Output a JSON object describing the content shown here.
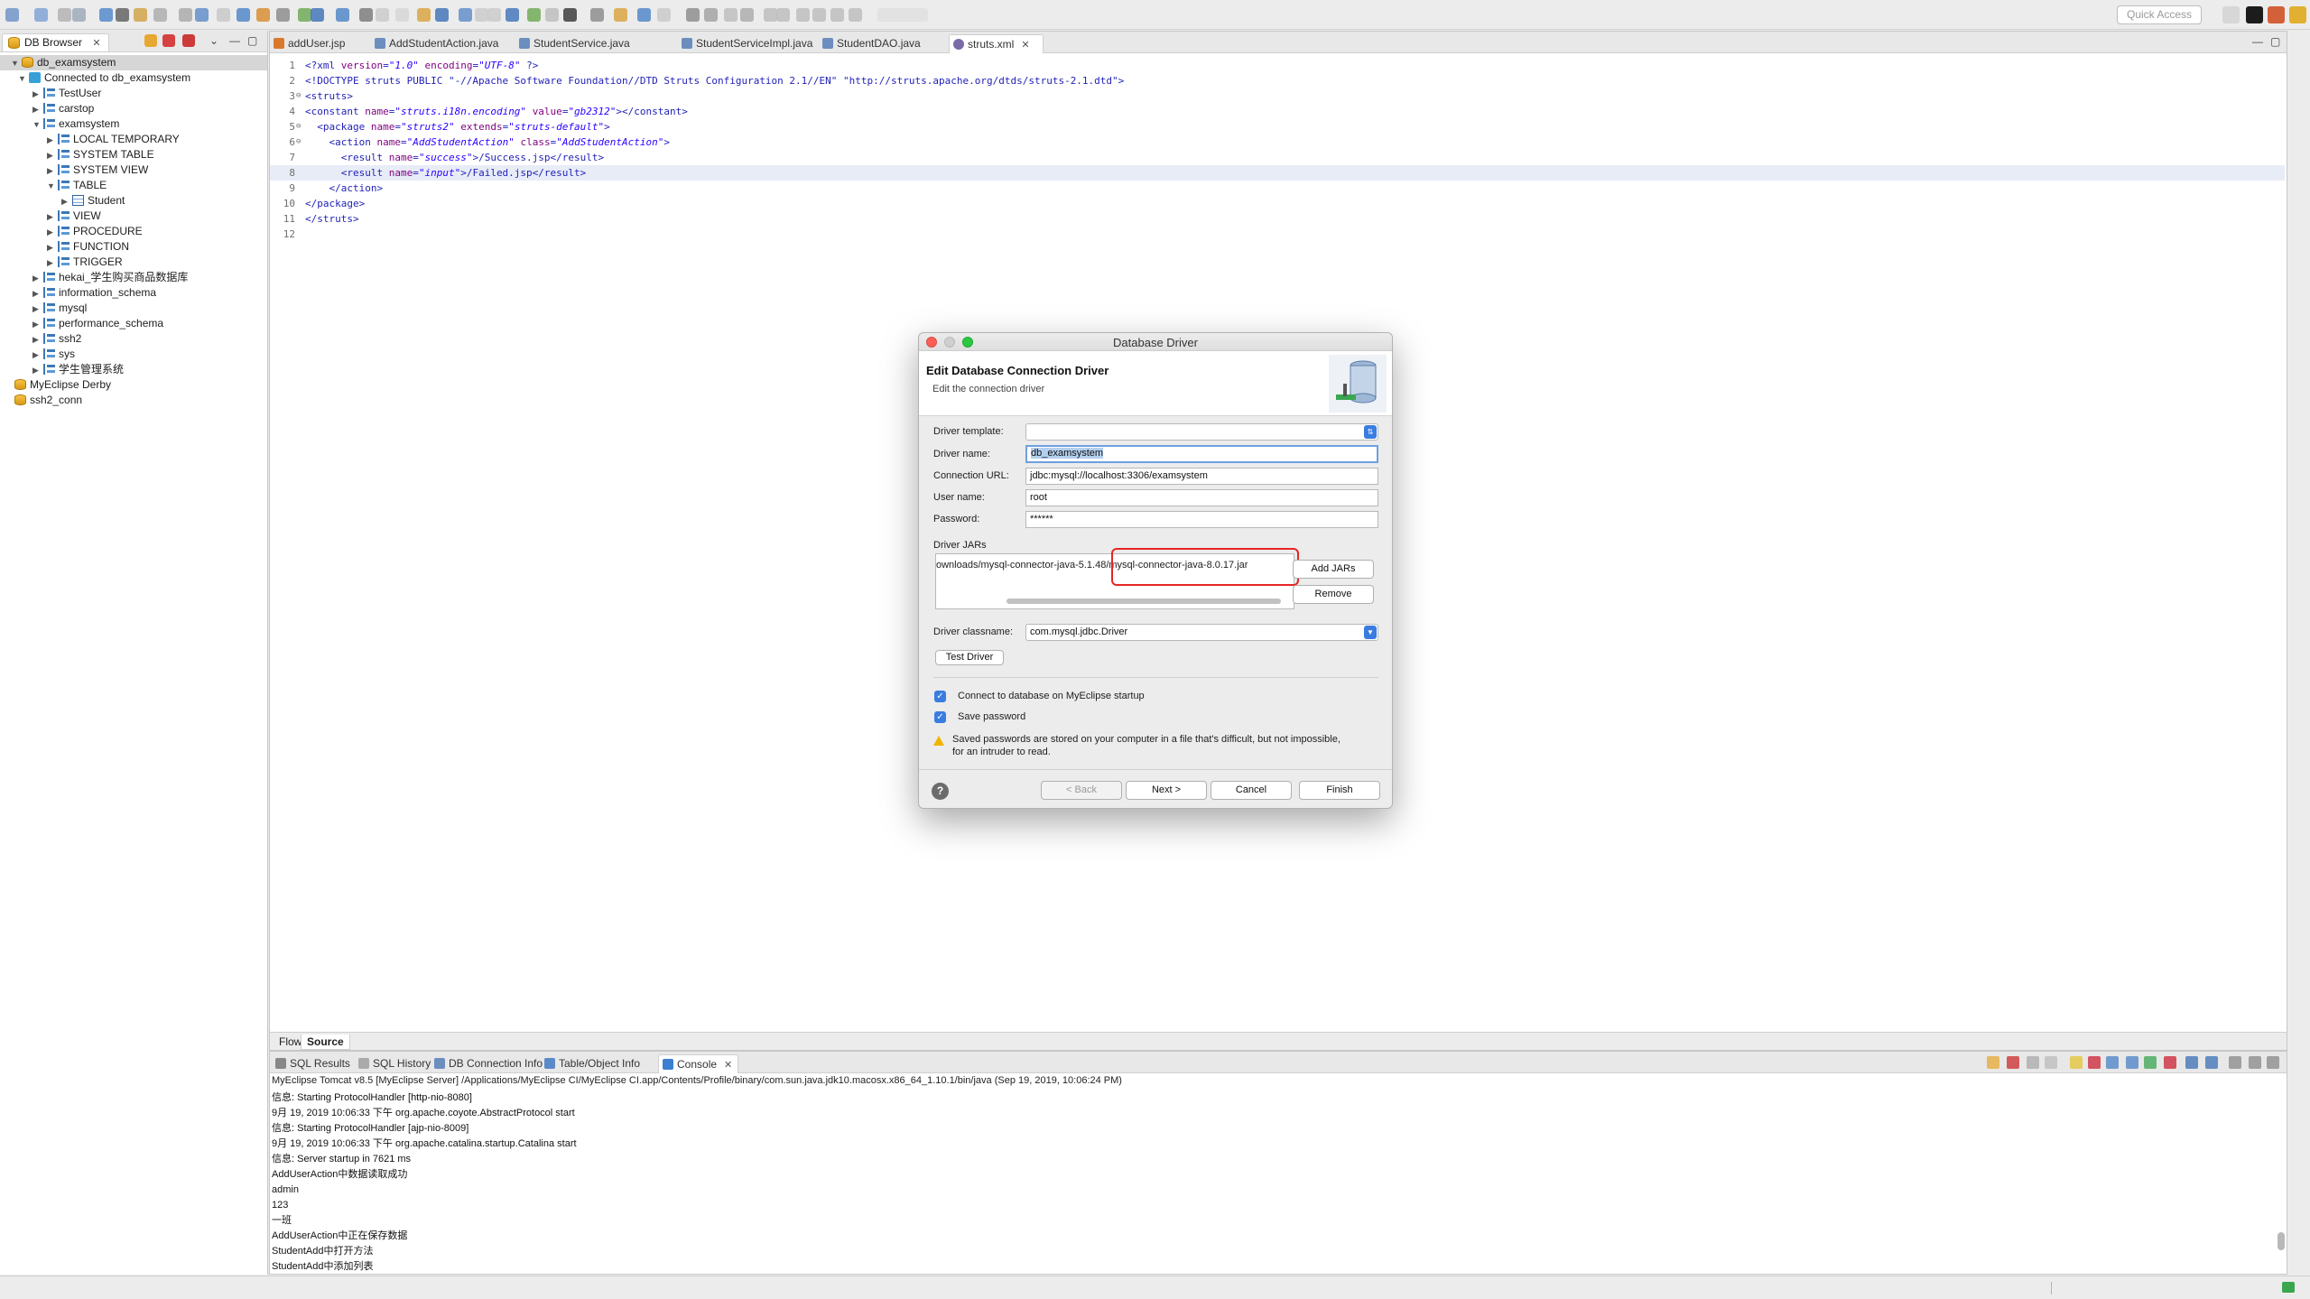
{
  "toolbar": {
    "quick_access_placeholder": "Quick Access"
  },
  "left_panel": {
    "tab_label": "DB Browser",
    "tree": [
      {
        "label": "db_examsystem",
        "depth": 0,
        "arrow": "▼",
        "icon": "database-icon",
        "selected": true
      },
      {
        "label": "Connected to db_examsystem",
        "depth": 1,
        "arrow": "▼",
        "icon": "connection-icon"
      },
      {
        "label": "TestUser",
        "depth": 2,
        "arrow": "▶",
        "icon": "schema-icon"
      },
      {
        "label": "carstop",
        "depth": 2,
        "arrow": "▶",
        "icon": "schema-icon"
      },
      {
        "label": "examsystem",
        "depth": 2,
        "arrow": "▼",
        "icon": "schema-icon"
      },
      {
        "label": "LOCAL TEMPORARY",
        "depth": 3,
        "arrow": "▶",
        "icon": "schema-icon"
      },
      {
        "label": "SYSTEM TABLE",
        "depth": 3,
        "arrow": "▶",
        "icon": "schema-icon"
      },
      {
        "label": "SYSTEM VIEW",
        "depth": 3,
        "arrow": "▶",
        "icon": "schema-icon"
      },
      {
        "label": "TABLE",
        "depth": 3,
        "arrow": "▼",
        "icon": "schema-icon"
      },
      {
        "label": "Student",
        "depth": 4,
        "arrow": "▶",
        "icon": "table-icon"
      },
      {
        "label": "VIEW",
        "depth": 3,
        "arrow": "▶",
        "icon": "schema-icon"
      },
      {
        "label": "PROCEDURE",
        "depth": 3,
        "arrow": "▶",
        "icon": "schema-icon"
      },
      {
        "label": "FUNCTION",
        "depth": 3,
        "arrow": "▶",
        "icon": "schema-icon"
      },
      {
        "label": "TRIGGER",
        "depth": 3,
        "arrow": "▶",
        "icon": "schema-icon"
      },
      {
        "label": "hekai_学生购买商品数据库",
        "depth": 2,
        "arrow": "▶",
        "icon": "schema-icon"
      },
      {
        "label": "information_schema",
        "depth": 2,
        "arrow": "▶",
        "icon": "schema-icon"
      },
      {
        "label": "mysql",
        "depth": 2,
        "arrow": "▶",
        "icon": "schema-icon"
      },
      {
        "label": "performance_schema",
        "depth": 2,
        "arrow": "▶",
        "icon": "schema-icon"
      },
      {
        "label": "ssh2",
        "depth": 2,
        "arrow": "▶",
        "icon": "schema-icon"
      },
      {
        "label": "sys",
        "depth": 2,
        "arrow": "▶",
        "icon": "schema-icon"
      },
      {
        "label": "学生管理系统",
        "depth": 2,
        "arrow": "▶",
        "icon": "schema-icon"
      },
      {
        "label": "MyEclipse Derby",
        "depth": 0,
        "arrow": "",
        "icon": "database-icon"
      },
      {
        "label": "ssh2_conn",
        "depth": 0,
        "arrow": "",
        "icon": "database-icon"
      }
    ]
  },
  "editor": {
    "tabs": [
      {
        "label": "addUser.jsp",
        "active": false
      },
      {
        "label": "AddStudentAction.java",
        "active": false
      },
      {
        "label": "StudentService.java",
        "active": false
      },
      {
        "label": "StudentServiceImpl.java",
        "active": false
      },
      {
        "label": "StudentDAO.java",
        "active": false
      },
      {
        "label": "struts.xml",
        "active": true
      }
    ],
    "lines": [
      {
        "n": "1",
        "fold": "",
        "text": "<?xml version=\"1.0\" encoding=\"UTF-8\" ?>"
      },
      {
        "n": "2",
        "fold": "",
        "text": "<!DOCTYPE struts PUBLIC \"-//Apache Software Foundation//DTD Struts Configuration 2.1//EN\" \"http://struts.apache.org/dtds/struts-2.1.dtd\">"
      },
      {
        "n": "3",
        "fold": "⊖",
        "text": "<struts>"
      },
      {
        "n": "4",
        "fold": "",
        "text": "<constant name=\"struts.i18n.encoding\" value=\"gb2312\"></constant>"
      },
      {
        "n": "5",
        "fold": "⊖",
        "text": "  <package name=\"struts2\" extends=\"struts-default\">"
      },
      {
        "n": "6",
        "fold": "⊖",
        "text": "    <action name=\"AddStudentAction\" class=\"AddStudentAction\">"
      },
      {
        "n": "7",
        "fold": "",
        "text": "      <result name=\"success\">/Success.jsp</result>"
      },
      {
        "n": "8",
        "fold": "",
        "text": "      <result name=\"input\">/Failed.jsp</result>",
        "current": true
      },
      {
        "n": "9",
        "fold": "",
        "text": "    </action>"
      },
      {
        "n": "10",
        "fold": "",
        "text": "</package>"
      },
      {
        "n": "11",
        "fold": "",
        "text": "</struts>"
      },
      {
        "n": "12",
        "fold": "",
        "text": ""
      }
    ],
    "bottom_tabs": {
      "flow": "Flow",
      "source": "Source"
    }
  },
  "console": {
    "tabs": [
      {
        "label": "SQL Results",
        "active": false
      },
      {
        "label": "SQL History",
        "active": false
      },
      {
        "label": "DB Connection Info",
        "active": false
      },
      {
        "label": "Table/Object Info",
        "active": false
      },
      {
        "label": "Console",
        "active": true
      }
    ],
    "header": "MyEclipse Tomcat v8.5 [MyEclipse Server] /Applications/MyEclipse CI/MyEclipse CI.app/Contents/Profile/binary/com.sun.java.jdk10.macosx.x86_64_1.10.1/bin/java (Sep 19, 2019, 10:06:24 PM)",
    "lines": [
      {
        "text": "信息: Starting ProtocolHandler [http-nio-8080]",
        "red": false
      },
      {
        "text": "9月 19, 2019 10:06:33 下午 org.apache.coyote.AbstractProtocol start",
        "red": false
      },
      {
        "text": "信息: Starting ProtocolHandler [ajp-nio-8009]",
        "red": false
      },
      {
        "text": "9月 19, 2019 10:06:33 下午 org.apache.catalina.startup.Catalina start",
        "red": false
      },
      {
        "text": "信息: Server startup in 7621 ms",
        "red": false
      },
      {
        "text": "AddUserAction中数据读取成功",
        "red": false
      },
      {
        "text": "admin",
        "red": false
      },
      {
        "text": "123",
        "red": false
      },
      {
        "text": "一班",
        "red": false
      },
      {
        "text": "AddUserAction中正在保存数据",
        "red": false
      },
      {
        "text": "StudentAdd中打开方法",
        "red": false
      },
      {
        "text": "StudentAdd中添加列表",
        "red": false
      }
    ]
  },
  "dialog": {
    "title": "Database Driver",
    "heading": "Edit Database Connection Driver",
    "subheading": "Edit the connection driver",
    "driver_template_label": "Driver template:",
    "driver_template_value": "",
    "driver_name_label": "Driver name:",
    "driver_name_value": "db_examsystem",
    "connection_url_label": "Connection URL:",
    "connection_url_value": "jdbc:mysql://localhost:3306/examsystem",
    "user_name_label": "User name:",
    "user_name_value": "root",
    "password_label": "Password:",
    "password_value": "******",
    "driver_jars_label": "Driver JARs",
    "jar_entry": "ownloads/mysql-connector-java-5.1.48/mysql-connector-java-8.0.17.jar",
    "add_jars_label": "Add JARs",
    "remove_label": "Remove",
    "driver_classname_label": "Driver classname:",
    "driver_classname_value": "com.mysql.jdbc.Driver",
    "test_driver_label": "Test Driver",
    "connect_on_startup_label": "Connect to database on MyEclipse startup",
    "connect_on_startup_checked": true,
    "save_password_label": "Save password",
    "save_password_checked": true,
    "warning_text": "Saved passwords are stored on your computer in a file that's difficult, but not impossible, for an intruder to read.",
    "back_label": "< Back",
    "next_label": "Next >",
    "cancel_label": "Cancel",
    "finish_label": "Finish",
    "help_symbol": "?"
  },
  "colors": {
    "accent": "#3a7de0",
    "highlight_box": "#e52626",
    "xml_tag": "#1f1fb7",
    "xml_attr": "#7f007f",
    "xml_value": "#2a00ff"
  }
}
